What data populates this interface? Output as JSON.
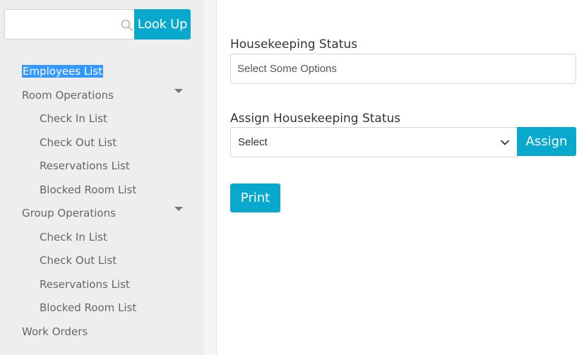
{
  "search": {
    "value": "",
    "placeholder": "",
    "button_label": "Look Up",
    "icon": "search-icon"
  },
  "sidebar": {
    "items": [
      {
        "label": "Employees List",
        "level": 0,
        "selected": true
      },
      {
        "label": "Room Operations",
        "level": 0,
        "expandable": true
      },
      {
        "label": "Check In List",
        "level": 1
      },
      {
        "label": "Check Out List",
        "level": 1
      },
      {
        "label": "Reservations List",
        "level": 1
      },
      {
        "label": "Blocked Room List",
        "level": 1
      },
      {
        "label": "Group Operations",
        "level": 0,
        "expandable": true
      },
      {
        "label": "Check In List",
        "level": 1
      },
      {
        "label": "Check Out List",
        "level": 1
      },
      {
        "label": "Reservations List",
        "level": 1
      },
      {
        "label": "Blocked Room List",
        "level": 1
      },
      {
        "label": "Work Orders",
        "level": 0
      }
    ]
  },
  "main": {
    "housekeeping_status": {
      "label": "Housekeeping Status",
      "placeholder": "Select Some Options"
    },
    "assign_status": {
      "label": "Assign Housekeeping Status",
      "selected": "Select",
      "button_label": "Assign"
    },
    "print_label": "Print"
  },
  "colors": {
    "accent": "#09a9cd",
    "selection": "#3399ff",
    "sidebar_bg": "#eeeeee"
  }
}
